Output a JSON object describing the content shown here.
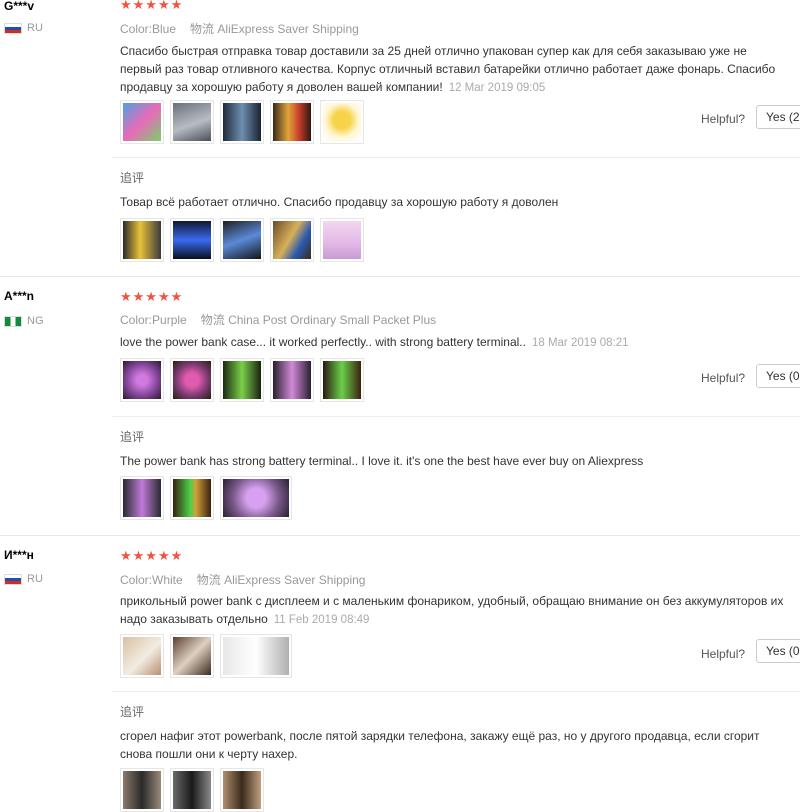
{
  "labels": {
    "color": "Color:",
    "logistics": "物流",
    "followup": "追评",
    "helpful": "Helpful?",
    "stars": "★★★★★"
  },
  "reviews": [
    {
      "user": "G***v",
      "country": "RU",
      "flag": "ru",
      "color": "Blue",
      "shipping": "AliExpress Saver Shipping",
      "text": "Спасибо быстрая отправка товар доставили за 25 дней отлично упакован супер как для себя заказываю уже не первый раз товар отливного качества. Корпус отличный вставил батарейки отлично работает даже фонарь. Спасибо продавцу за хорошую работу я доволен вашей компании!",
      "date": "12 Mar 2019 09:05",
      "yes": "Yes (2",
      "followup_text": "Товар всё работает отлично. Спасибо продавцу за хорошую работу я доволен"
    },
    {
      "user": "A***n",
      "country": "NG",
      "flag": "ng",
      "color": "Purple",
      "shipping": "China Post Ordinary Small Packet Plus",
      "text": "love the power bank case... it worked perfectly.. with strong battery terminal..",
      "date": "18 Mar 2019 08:21",
      "yes": "Yes (0",
      "followup_text": "The power bank has strong battery terminal.. I love it. it's one the best have ever buy on Aliexpress"
    },
    {
      "user": "И***н",
      "country": "RU",
      "flag": "ru",
      "color": "White",
      "shipping": "AliExpress Saver Shipping",
      "text": "прикольный power bank с дисплеем и с маленьким фонариком, удобный, обращаю внимание он без аккумуляторов их надо заказывать отдельно",
      "date": "11 Feb 2019 08:49",
      "yes": "Yes (0",
      "followup_text": "сгорел нафиг этот powerbank, после пятой зарядки телефона, закажу ещё раз, но у другого продавца, если сгорит снова пошли они к черту нахер."
    }
  ]
}
